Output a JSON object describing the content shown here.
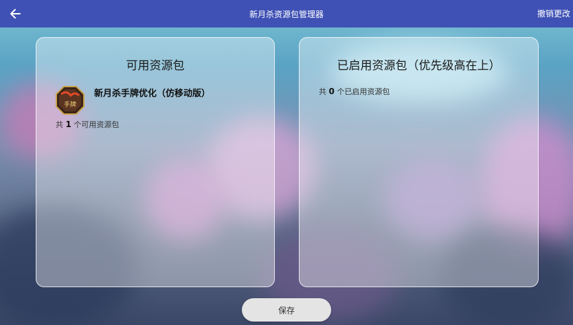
{
  "header": {
    "title": "新月杀资源包管理器",
    "undo_label": "撤销更改",
    "back_icon": "arrow-left-icon"
  },
  "available_panel": {
    "title": "可用资源包",
    "items": [
      {
        "name": "新月杀手牌优化（仿移动版）",
        "icon": "pack-logo-icon",
        "icon_text": "手牌"
      }
    ],
    "count_prefix": "共",
    "count": "1",
    "count_suffix": "个可用资源包"
  },
  "enabled_panel": {
    "title": "已启用资源包（优先级高在上）",
    "count_prefix": "共",
    "count": "0",
    "count_suffix": "个已启用资源包"
  },
  "footer": {
    "save_label": "保存"
  },
  "colors": {
    "topbar": "#3f51b5",
    "save_button": "#e4e4e4"
  }
}
